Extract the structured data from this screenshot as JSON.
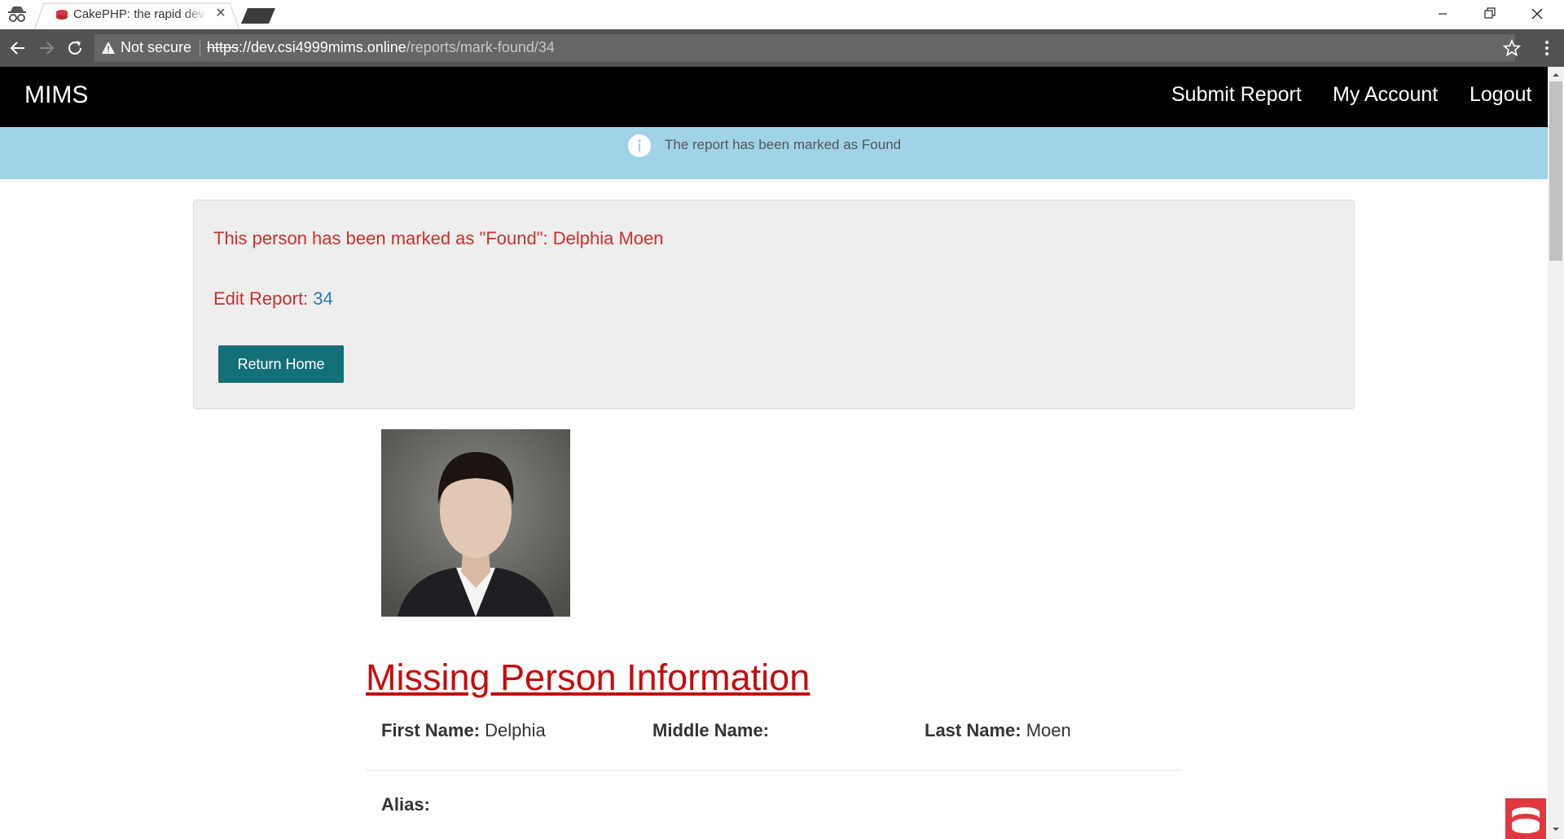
{
  "browser": {
    "tab_title": "CakePHP: the rapid development",
    "security_label": "Not secure",
    "url_scheme": "https",
    "url_host": "://dev.csi4999mims.online",
    "url_path": "/reports/mark-found/34"
  },
  "navbar": {
    "brand": "MIMS",
    "links": [
      "Submit Report",
      "My Account",
      "Logout"
    ]
  },
  "flash": {
    "message": "The report has been marked as Found",
    "color": "#a0d3e8"
  },
  "panel": {
    "found_message": "This person has been marked as \"Found\": Delphia Moen",
    "edit_label": "Edit Report:",
    "edit_link": "34",
    "return_button": "Return Home"
  },
  "section": {
    "title": "Missing Person Information",
    "first_name_label": "First Name:",
    "first_name": "Delphia",
    "middle_name_label": "Middle Name:",
    "middle_name": "",
    "last_name_label": "Last Name:",
    "last_name": "Moen",
    "alias_label": "Alias:",
    "alias": ""
  },
  "colors": {
    "accent_red": "#c30d0d",
    "button_teal": "#136f78",
    "link_blue": "#337ab7"
  }
}
